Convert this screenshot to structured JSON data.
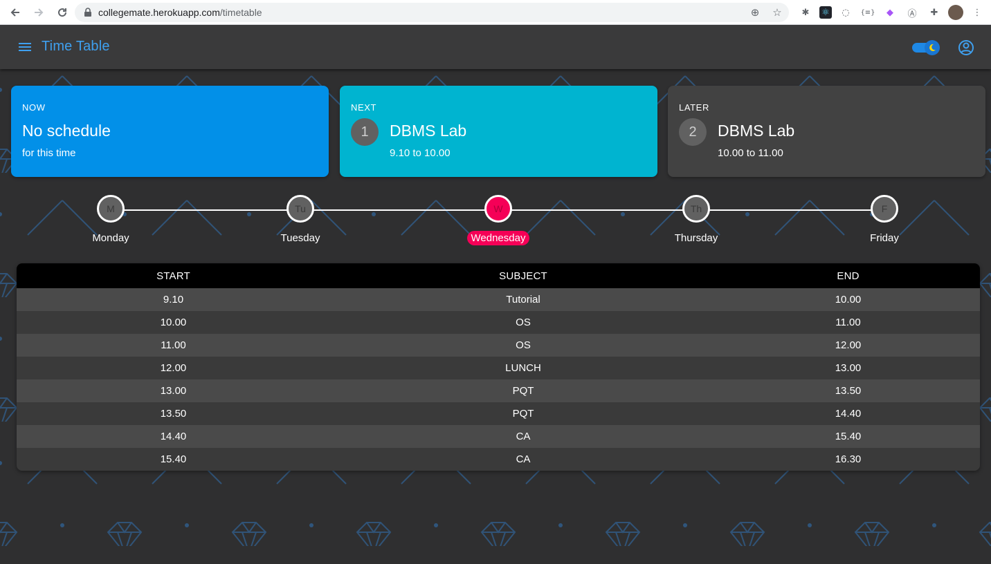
{
  "browser": {
    "url_host": "collegemate.herokuapp.com",
    "url_path": "/timetable"
  },
  "appbar": {
    "title": "Time Table"
  },
  "cards": {
    "now": {
      "label": "NOW",
      "title": "No schedule",
      "sub": "for this time"
    },
    "next": {
      "label": "NEXT",
      "number": "1",
      "title": "DBMS Lab",
      "sub": "9.10 to 10.00"
    },
    "later": {
      "label": "LATER",
      "number": "2",
      "title": "DBMS Lab",
      "sub": "10.00 to 11.00"
    }
  },
  "days": [
    {
      "abbr": "M",
      "name": "Monday"
    },
    {
      "abbr": "Tu",
      "name": "Tuesday"
    },
    {
      "abbr": "W",
      "name": "Wednesday",
      "active": true
    },
    {
      "abbr": "Th",
      "name": "Thursday"
    },
    {
      "abbr": "F",
      "name": "Friday"
    }
  ],
  "table": {
    "headers": [
      "START",
      "SUBJECT",
      "END"
    ],
    "rows": [
      [
        "9.10",
        "Tutorial",
        "10.00"
      ],
      [
        "10.00",
        "OS",
        "11.00"
      ],
      [
        "11.00",
        "OS",
        "12.00"
      ],
      [
        "12.00",
        "LUNCH",
        "13.00"
      ],
      [
        "13.00",
        "PQT",
        "13.50"
      ],
      [
        "13.50",
        "PQT",
        "14.40"
      ],
      [
        "14.40",
        "CA",
        "15.40"
      ],
      [
        "15.40",
        "CA",
        "16.30"
      ]
    ]
  },
  "colors": {
    "accent": "#3fa0ef",
    "now_card": "#0290e8",
    "next_card": "#00b4d0",
    "later_card": "#424242",
    "active_day": "#f50057"
  }
}
